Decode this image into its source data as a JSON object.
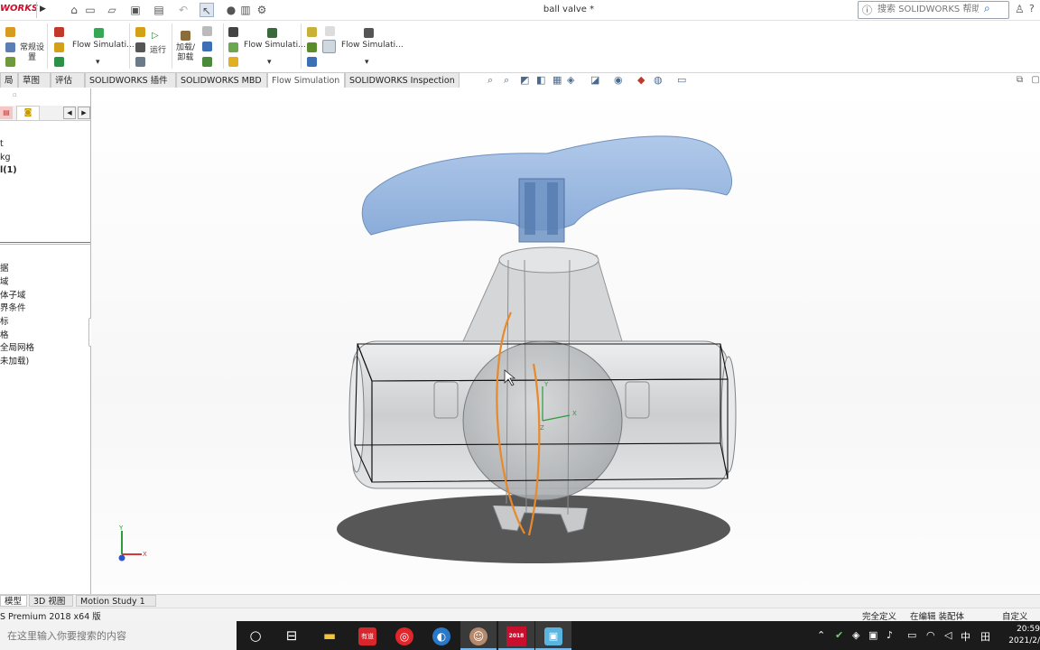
{
  "titlebar": {
    "logo": "WORKS",
    "document_title": "ball valve *",
    "help_search_placeholder": "搜索 SOLIDWORKS 帮助",
    "help_icon": "?"
  },
  "command_manager": {
    "commands": [
      {
        "id": "general-settings",
        "label": "常规设\n置"
      },
      {
        "id": "flow-sim-1",
        "label": "Flow Simulati..."
      },
      {
        "id": "run",
        "label": "运行"
      },
      {
        "id": "load-unload",
        "label": "加载/\n卸载"
      },
      {
        "id": "flow-sim-2",
        "label": "Flow Simulati..."
      },
      {
        "id": "flow-sim-3",
        "label": "Flow Simulati..."
      }
    ]
  },
  "tabs": [
    {
      "label": "局",
      "active": false
    },
    {
      "label": "草图",
      "active": false
    },
    {
      "label": "评估",
      "active": false
    },
    {
      "label": "SOLIDWORKS 插件",
      "active": false
    },
    {
      "label": "SOLIDWORKS MBD",
      "active": false
    },
    {
      "label": "Flow Simulation",
      "active": true
    },
    {
      "label": "SOLIDWORKS Inspection",
      "active": false
    }
  ],
  "feature_tree": {
    "top_items": [
      "t",
      "kg",
      "l(1)"
    ],
    "items": [
      "据",
      "域",
      "体子域",
      "界条件",
      "标",
      "格",
      "全局网格",
      "未加载)"
    ]
  },
  "viewport": {
    "triad_labels": {
      "y": "Y",
      "x": "X"
    },
    "local_triad_labels": {
      "y": "Y",
      "z": "Z",
      "x": "X"
    }
  },
  "bottom_tabs": [
    {
      "label": "模型",
      "active": true
    },
    {
      "label": "3D 视图",
      "active": false
    },
    {
      "label": "Motion Study 1",
      "active": false
    }
  ],
  "status": {
    "product": "S Premium 2018 x64 版",
    "fully_defined": "完全定义",
    "editing": "在编辑 装配体",
    "custom": "自定义"
  },
  "taskbar": {
    "search_placeholder": "在这里输入你要搜索的内容",
    "app_icons": [
      "cortana-icon",
      "task-view-icon",
      "file-explorer-icon",
      "youdao-icon",
      "netease-music-icon",
      "browser-icon",
      "avatar-app-icon",
      "solidworks-app-icon",
      "image-app-icon"
    ],
    "solidworks_badge": "2018",
    "youdao_label": "有道",
    "tray_ime": "中",
    "tray_grid": "田",
    "clock_time": "20:59",
    "clock_date": "2021/2/"
  },
  "colors": {
    "solidworks_red": "#c8102e",
    "handle_blue": "#8fb2df",
    "selection_orange": "#e8892a",
    "triad_red": "#d43a2f",
    "triad_green": "#2e9c3a",
    "triad_blue": "#2f56c9"
  }
}
